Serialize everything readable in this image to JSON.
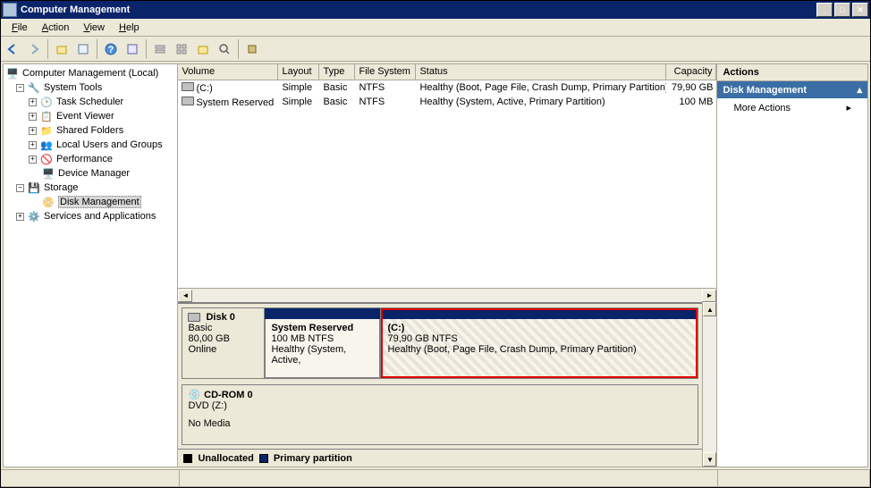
{
  "window": {
    "title": "Computer Management"
  },
  "menu": {
    "file": "File",
    "action": "Action",
    "view": "View",
    "help": "Help"
  },
  "tree": {
    "root": "Computer Management (Local)",
    "systemTools": "System Tools",
    "taskScheduler": "Task Scheduler",
    "eventViewer": "Event Viewer",
    "sharedFolders": "Shared Folders",
    "localUsers": "Local Users and Groups",
    "performance": "Performance",
    "deviceManager": "Device Manager",
    "storage": "Storage",
    "diskManagement": "Disk Management",
    "servicesApps": "Services and Applications"
  },
  "columns": {
    "volume": "Volume",
    "layout": "Layout",
    "type": "Type",
    "fs": "File System",
    "status": "Status",
    "capacity": "Capacity"
  },
  "volumes": [
    {
      "name": "(C:)",
      "layout": "Simple",
      "type": "Basic",
      "fs": "NTFS",
      "status": "Healthy (Boot, Page File, Crash Dump, Primary Partition)",
      "capacity": "79,90 GB"
    },
    {
      "name": "System Reserved",
      "layout": "Simple",
      "type": "Basic",
      "fs": "NTFS",
      "status": "Healthy (System, Active, Primary Partition)",
      "capacity": "100 MB"
    }
  ],
  "disk0": {
    "name": "Disk 0",
    "type": "Basic",
    "size": "80,00 GB",
    "state": "Online",
    "part1": {
      "name": "System Reserved",
      "size": "100 MB NTFS",
      "status": "Healthy (System, Active,"
    },
    "part2": {
      "name": "(C:)",
      "size": "79,90 GB NTFS",
      "status": "Healthy (Boot, Page File, Crash Dump, Primary Partition)"
    }
  },
  "cdrom": {
    "name": "CD-ROM 0",
    "type": "DVD (Z:)",
    "state": "No Media"
  },
  "legend": {
    "unallocated": "Unallocated",
    "primary": "Primary partition"
  },
  "actions": {
    "header": "Actions",
    "selected": "Disk Management",
    "more": "More Actions"
  }
}
